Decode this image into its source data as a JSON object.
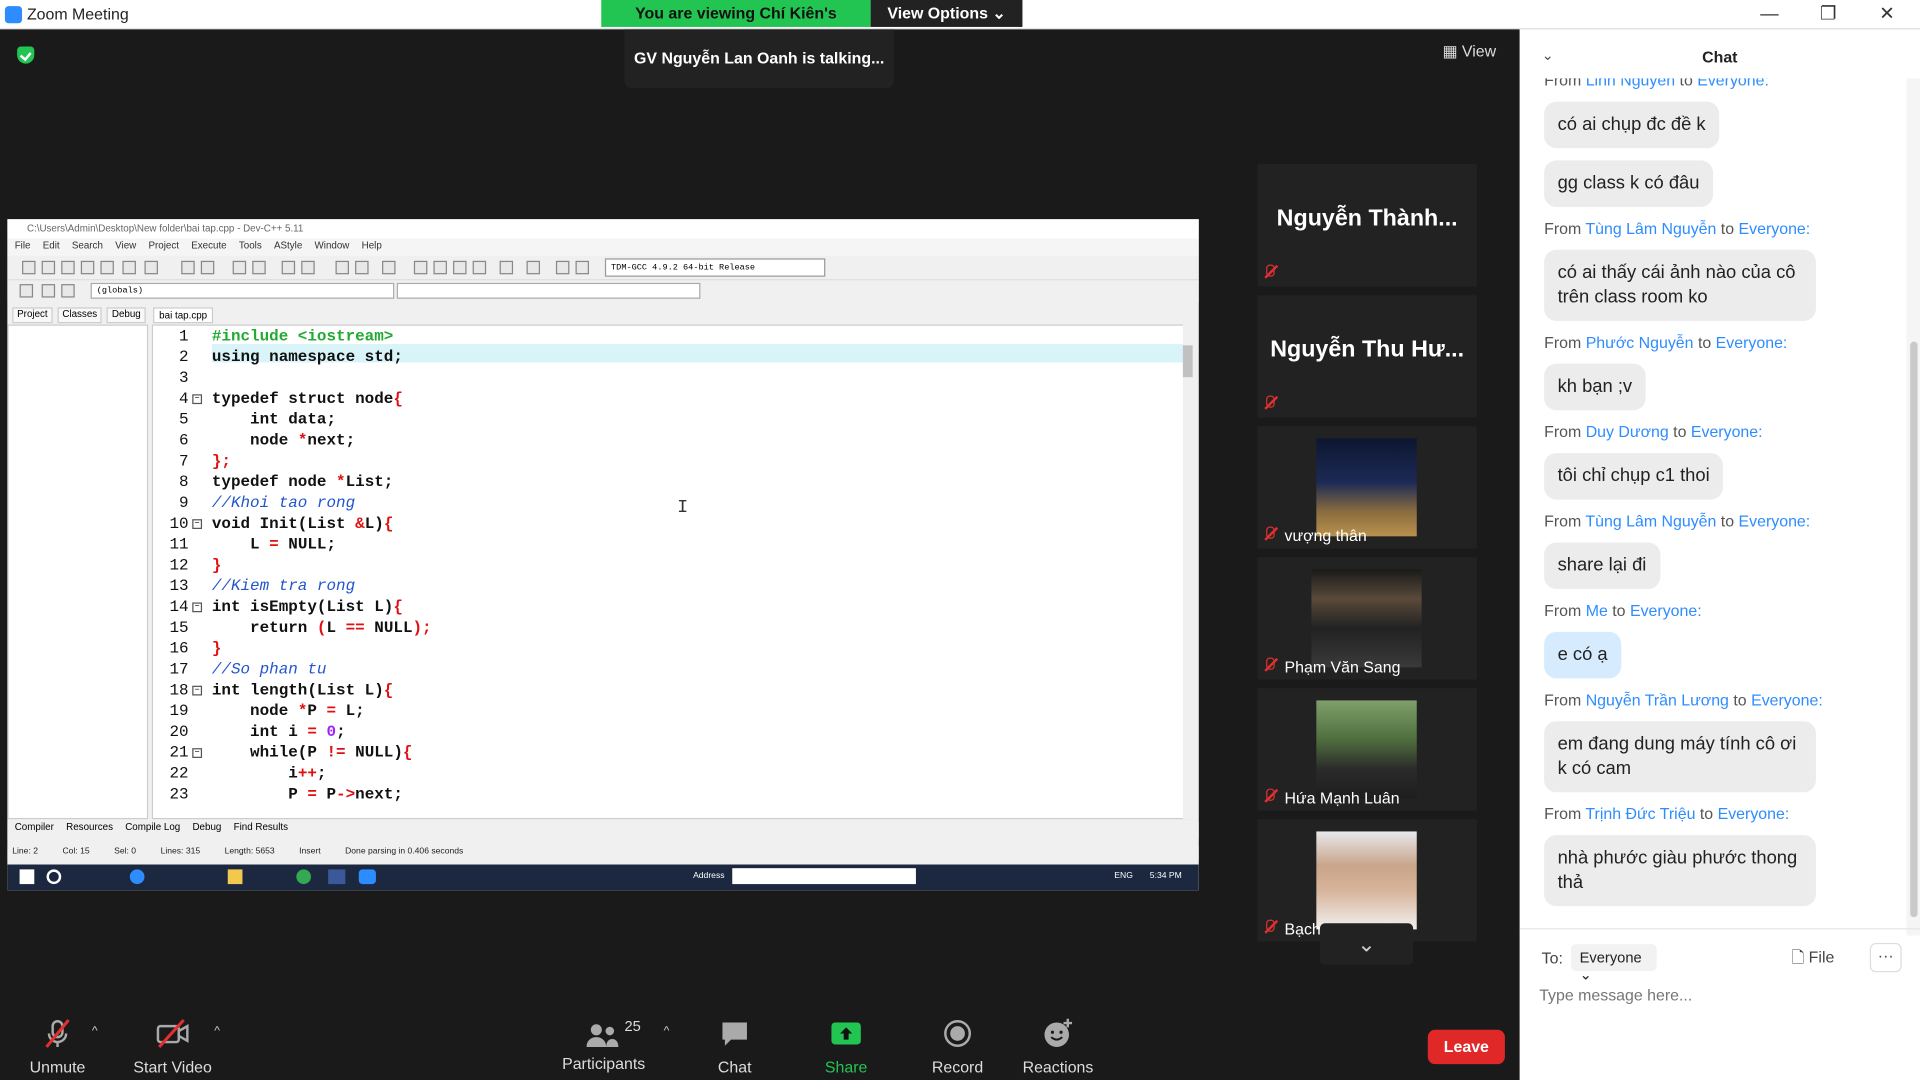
{
  "window": {
    "title": "Zoom Meeting",
    "minimize": "—",
    "maximize": "❐",
    "close": "✕"
  },
  "banner": {
    "viewing": "You are viewing Chí Kiên's screen",
    "view_options": "View Options ⌄"
  },
  "talking": "GV Nguyễn Lan Oanh is talking...",
  "view_button": "▦ View",
  "devcpp": {
    "title": "C:\\Users\\Admin\\Desktop\\New folder\\bai tap.cpp - Dev-C++ 5.11",
    "menu": [
      "File",
      "Edit",
      "Search",
      "View",
      "Project",
      "Execute",
      "Tools",
      "AStyle",
      "Window",
      "Help"
    ],
    "compiler": "TDM-GCC 4.9.2 64-bit Release",
    "globals": "(globals)",
    "left_tabs": [
      "Project",
      "Classes",
      "Debug"
    ],
    "file_tab": "bai tap.cpp",
    "bottom_tabs": [
      "Compiler",
      "Resources",
      "Compile Log",
      "Debug",
      "Find Results"
    ],
    "status": [
      "Line:   2",
      "Col:   15",
      "Sel:   0",
      "Lines:   315",
      "Length:   5653",
      "Insert",
      "Done parsing in 0.406 seconds"
    ],
    "taskbar": {
      "address": "Address",
      "lang": "ENG",
      "time": "5:34 PM"
    },
    "line_numbers": [
      "1",
      "2",
      "3",
      "4",
      "5",
      "6",
      "7",
      "8",
      "9",
      "10",
      "11",
      "12",
      "13",
      "14",
      "15",
      "16",
      "17",
      "18",
      "19",
      "20",
      "21",
      "22",
      "23"
    ]
  },
  "participants": [
    {
      "name": "Nguyễn  Thành...",
      "video": false
    },
    {
      "name": "Nguyễn Thu Hư...",
      "video": false
    },
    {
      "name": "vượng thân",
      "video": true
    },
    {
      "name": "Phạm Văn Sang",
      "video": true
    },
    {
      "name": "Hứa Mạnh Luân",
      "video": true
    },
    {
      "name": "Bạch Lương Phúc",
      "video": true
    }
  ],
  "toolbar": {
    "unmute": "Unmute",
    "start_video": "Start Video",
    "participants": "Participants",
    "participants_count": "25",
    "chat": "Chat",
    "share_screen": "Share Screen",
    "record": "Record",
    "reactions": "Reactions",
    "leave": "Leave"
  },
  "chat": {
    "title": "Chat",
    "from": "From",
    "to": "to",
    "messages": [
      {
        "sender": "Linh Nguyễn",
        "target": "Everyone:",
        "texts": [
          "có ai  chụp đc đề k",
          "gg class k có đâu"
        ]
      },
      {
        "sender": "Tùng Lâm Nguyễn",
        "target": "Everyone:",
        "texts": [
          "có ai thấy cái ảnh nào của cô trên class room ko"
        ]
      },
      {
        "sender": "Phước Nguyễn",
        "target": "Everyone:",
        "texts": [
          "kh bạn ;v"
        ]
      },
      {
        "sender": "Duy Dương",
        "target": "Everyone:",
        "texts": [
          "tôi chỉ chụp c1 thoi"
        ]
      },
      {
        "sender": "Tùng Lâm Nguyễn",
        "target": "Everyone:",
        "texts": [
          "share lại đi"
        ]
      },
      {
        "sender": "Me",
        "target": "Everyone:",
        "texts": [
          "e có ạ"
        ]
      },
      {
        "sender": "Nguyễn Trần Lương",
        "target": "Everyone:",
        "texts": [
          "em đang dung máy tính cô ơi k có cam"
        ]
      },
      {
        "sender": "Trịnh Đức Triệu",
        "target": "Everyone:",
        "texts": [
          "nhà phước giàu phước thong thả"
        ]
      }
    ],
    "to_label": "To:",
    "to_value": "Everyone ⌄",
    "file": "File",
    "more": "···",
    "placeholder": "Type message here..."
  },
  "colors": {
    "accent": "#2d8cff",
    "banner_green": "#23c552",
    "leave_red": "#e02828"
  }
}
